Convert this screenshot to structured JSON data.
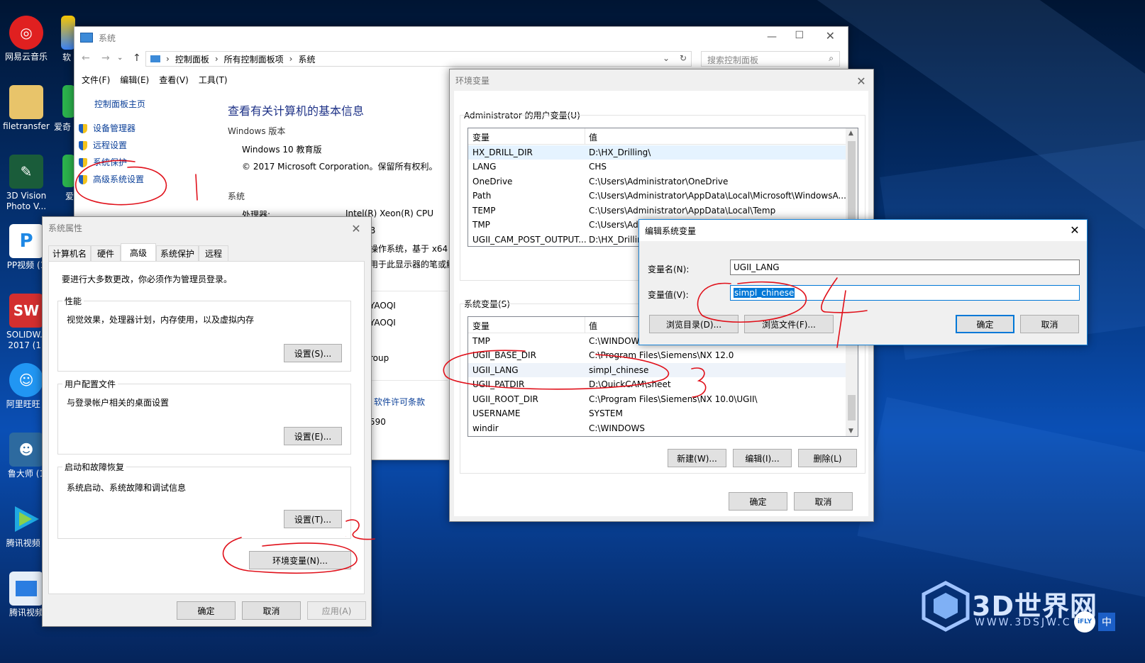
{
  "desktop": {
    "icons": [
      {
        "label": "网易云音乐",
        "icon": "netease-music-icon",
        "color": "#e02020"
      },
      {
        "label": "filetransfer",
        "icon": "folder-icon",
        "color": "#e8c46a"
      },
      {
        "label": "3D Vision Photo V...",
        "icon": "3d-vision-icon",
        "color": "#1a5c3a"
      },
      {
        "label": "PP视频 (1",
        "icon": "pp-video-icon",
        "color": "#1e88e5"
      },
      {
        "label": "SOLIDW... 2017 (1)",
        "icon": "solidworks-icon",
        "color": "#d32f2f"
      },
      {
        "label": "阿里旺旺 (",
        "icon": "aliwangwang-icon",
        "color": "#2196f3"
      },
      {
        "label": "鲁大师 (1",
        "icon": "ludashi-icon",
        "color": "#2d6a9f"
      },
      {
        "label": "腾讯视频 (",
        "icon": "tencent-video-icon",
        "color": "#1fa9e1"
      },
      {
        "label": "腾讯视频",
        "icon": "tencent-video-doc-icon",
        "color": "#2a7de1"
      }
    ],
    "partial_icons": [
      "软",
      "爱奇",
      "爱"
    ],
    "watermark": {
      "brand": "3D世界网",
      "url": "WWW.3DSJW.C",
      "badge": "中"
    }
  },
  "system_window": {
    "title": "系统",
    "breadcrumb": [
      "控制面板",
      "所有控制面板项",
      "系统"
    ],
    "search_placeholder": "搜索控制面板",
    "menu": [
      "文件(F)",
      "编辑(E)",
      "查看(V)",
      "工具(T)"
    ],
    "sidebar": {
      "home": "控制面板主页",
      "items": [
        "设备管理器",
        "远程设置",
        "系统保护",
        "高级系统设置"
      ]
    },
    "heading": "查看有关计算机的基本信息",
    "windows_edition_label": "Windows 版本",
    "edition": "Windows 10 教育版",
    "copyright": "© 2017 Microsoft Corporation。保留所有权利。",
    "system_label": "系统",
    "processor_label": "处理器:",
    "processor_value": "Intel(R) Xeon(R) CPU",
    "partial_texts": [
      "B",
      "操作系统，基于 x64 的",
      "用于此显示器的笔或触",
      "YAOQI",
      "YAOQI",
      "roup",
      "软件许可条款",
      "590"
    ]
  },
  "sys_props": {
    "title": "系统属性",
    "tabs": [
      "计算机名",
      "硬件",
      "高级",
      "系统保护",
      "远程"
    ],
    "admin_note": "要进行大多数更改，你必须作为管理员登录。",
    "perf": {
      "title": "性能",
      "desc": "视觉效果，处理器计划，内存使用，以及虚拟内存",
      "button": "设置(S)..."
    },
    "profile": {
      "title": "用户配置文件",
      "desc": "与登录帐户相关的桌面设置",
      "button": "设置(E)..."
    },
    "startup": {
      "title": "启动和故障恢复",
      "desc": "系统启动、系统故障和调试信息",
      "button": "设置(T)..."
    },
    "env_button": "环境变量(N)...",
    "ok": "确定",
    "cancel": "取消",
    "apply": "应用(A)"
  },
  "env_window": {
    "title": "环境变量",
    "user_group": "Administrator 的用户变量(U)",
    "col_var": "变量",
    "col_val": "值",
    "user_vars": [
      {
        "name": "HX_DRILL_DIR",
        "value": "D:\\HX_Drilling\\"
      },
      {
        "name": "LANG",
        "value": "CHS"
      },
      {
        "name": "OneDrive",
        "value": "C:\\Users\\Administrator\\OneDrive"
      },
      {
        "name": "Path",
        "value": "C:\\Users\\Administrator\\AppData\\Local\\Microsoft\\WindowsA..."
      },
      {
        "name": "TEMP",
        "value": "C:\\Users\\Administrator\\AppData\\Local\\Temp"
      },
      {
        "name": "TMP",
        "value": "C:\\Users\\Adr"
      },
      {
        "name": "UGII_CAM_POST_OUTPUT...",
        "value": "D:\\HX_Drillin"
      }
    ],
    "sys_group": "系统变量(S)",
    "sys_vars": [
      {
        "name": "TMP",
        "value": "C:\\WINDOW"
      },
      {
        "name": "UGII_BASE_DIR",
        "value": "C:\\Program Files\\Siemens\\NX 12.0"
      },
      {
        "name": "UGII_LANG",
        "value": "simpl_chinese"
      },
      {
        "name": "UGII_PATDIR",
        "value": "D:\\QuickCAM\\sheet"
      },
      {
        "name": "UGII_ROOT_DIR",
        "value": "C:\\Program Files\\Siemens\\NX 10.0\\UGII\\"
      },
      {
        "name": "USERNAME",
        "value": "SYSTEM"
      },
      {
        "name": "windir",
        "value": "C:\\WINDOWS"
      }
    ],
    "new": "新建(W)...",
    "edit": "编辑(I)...",
    "delete": "删除(L)",
    "ok": "确定",
    "cancel": "取消"
  },
  "edit_dialog": {
    "title": "编辑系统变量",
    "name_label": "变量名(N):",
    "name_value": "UGII_LANG",
    "value_label": "变量值(V):",
    "value_value": "simpl_chinese",
    "browse_dir": "浏览目录(D)...",
    "browse_file": "浏览文件(F)...",
    "ok": "确定",
    "cancel": "取消"
  },
  "annotations": {
    "step2": "2",
    "step3": "3",
    "step4": "4",
    "color": "#e0101a"
  }
}
